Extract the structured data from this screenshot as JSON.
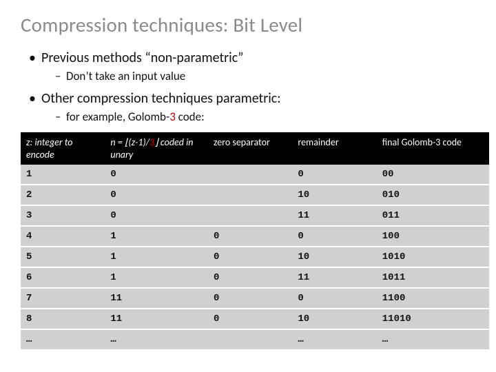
{
  "title": "Compression techniques: Bit Level",
  "bullets": {
    "b1": "Previous methods “non-parametric”",
    "b1a": "Don’t take an input value",
    "b2": "Other compression techniques parametric:",
    "b2a_prefix": "for example, Golomb-",
    "b2a_num": "3",
    "b2a_suffix": " code:"
  },
  "headers": {
    "h0": "z: integer to encode",
    "h1_pre": "n = ⌊(z-1)/",
    "h1_num": "3",
    "h1_post": "⌋ coded in unary",
    "h2": "zero separator",
    "h3": "remainder",
    "h4": "final Golomb-3 code"
  },
  "col_widths": [
    "18%",
    "22%",
    "18%",
    "18%",
    "24%"
  ],
  "chart_data": {
    "type": "table",
    "columns": [
      "z: integer to encode",
      "n = ⌊(z-1)/3⌋ coded in unary",
      "zero separator",
      "remainder",
      "final Golomb-3 code"
    ],
    "rows": [
      [
        "1",
        "0",
        "",
        "0",
        "00"
      ],
      [
        "2",
        "0",
        "",
        "10",
        "010"
      ],
      [
        "3",
        "0",
        "",
        "11",
        "011"
      ],
      [
        "4",
        "1",
        "0",
        "0",
        "100"
      ],
      [
        "5",
        "1",
        "0",
        "10",
        "1010"
      ],
      [
        "6",
        "1",
        "0",
        "11",
        "1011"
      ],
      [
        "7",
        "11",
        "0",
        "0",
        "1100"
      ],
      [
        "8",
        "11",
        "0",
        "10",
        "11010"
      ],
      [
        "…",
        "…",
        "",
        "…",
        "…"
      ]
    ]
  }
}
